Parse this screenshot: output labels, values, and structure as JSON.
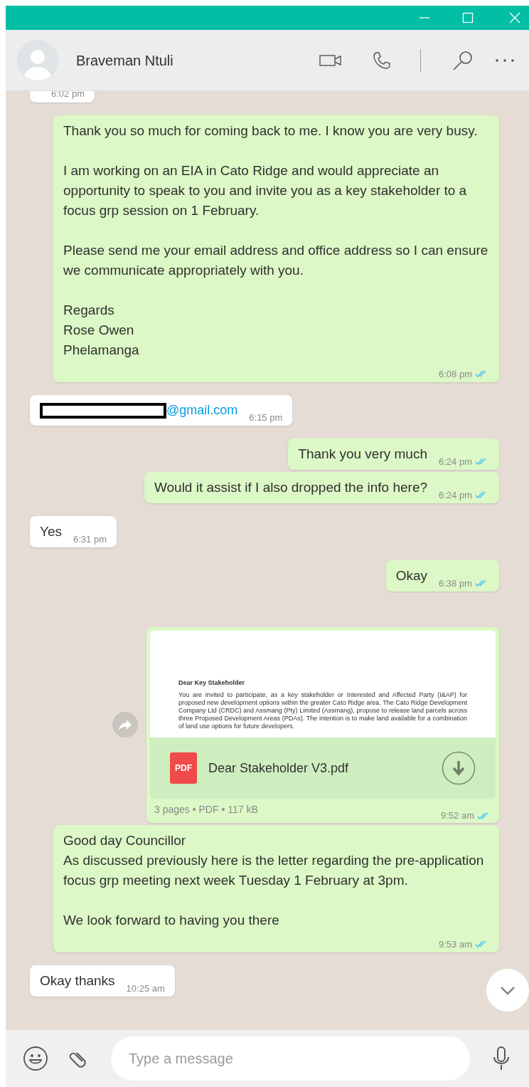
{
  "header": {
    "contact_name": "Braveman Ntuli"
  },
  "messages": [
    {
      "kind": "text",
      "outgoing": false,
      "time": "6:02 pm"
    },
    {
      "kind": "text",
      "outgoing": true,
      "paragraphs": [
        "Thank you so much for coming back to me. I know you are very busy.",
        "I am working on  an EIA in Cato Ridge and would appreciate an opportunity to speak to you and invite you as a key stakeholder to a focus grp session on 1 February.",
        "Please send me your email address  and office address so I can ensure we communicate appropriately with you.",
        "Regards\nRose Owen\nPhelamanga"
      ],
      "time": "6:08 pm",
      "read": true
    },
    {
      "kind": "email",
      "outgoing": false,
      "redacted": true,
      "link": "@gmail.com",
      "time": "6:15 pm"
    },
    {
      "kind": "text",
      "outgoing": true,
      "paragraphs": [
        "Thank you very much"
      ],
      "time": "6:24 pm",
      "read": true
    },
    {
      "kind": "text",
      "outgoing": true,
      "paragraphs": [
        "Would it assist if I also dropped the info here?"
      ],
      "time": "6:24 pm",
      "read": true
    },
    {
      "kind": "text",
      "outgoing": false,
      "paragraphs": [
        "Yes"
      ],
      "time": "6:31 pm"
    },
    {
      "kind": "text",
      "outgoing": true,
      "paragraphs": [
        "Okay"
      ],
      "time": "6:38 pm",
      "read": true
    },
    {
      "kind": "document",
      "outgoing": true,
      "preview_title": "Dear Key Stakeholder",
      "preview_body": "You are invited to participate, as a key stakeholder or Interested and Affected Party (I&AP) for proposed new development options within the greater Cato Ridge area. The Cato Ridge Development Company Ltd (CRDC) and Assmang (Pty) Limited (Assmang), propose to release land parcels across three Proposed Development Areas (PDAs). The intention is to make land available for a combination of land use options for future developers.",
      "icon_label": "PDF",
      "file_name": "Dear Stakeholder V3.pdf",
      "meta": "3 pages • PDF • 117 kB",
      "time": "9:52 am",
      "read": true
    },
    {
      "kind": "text",
      "outgoing": true,
      "paragraphs": [
        "Good day Councillor\nAs discussed previously here is the letter regarding the pre-application focus grp meeting next week Tuesday 1 February at 3pm.",
        "We look forward to having you there"
      ],
      "time": "9:53 am",
      "read": true
    },
    {
      "kind": "text",
      "outgoing": false,
      "paragraphs": [
        "Okay thanks"
      ],
      "time": "10:25 am"
    }
  ],
  "composer": {
    "placeholder": "Type a message"
  }
}
